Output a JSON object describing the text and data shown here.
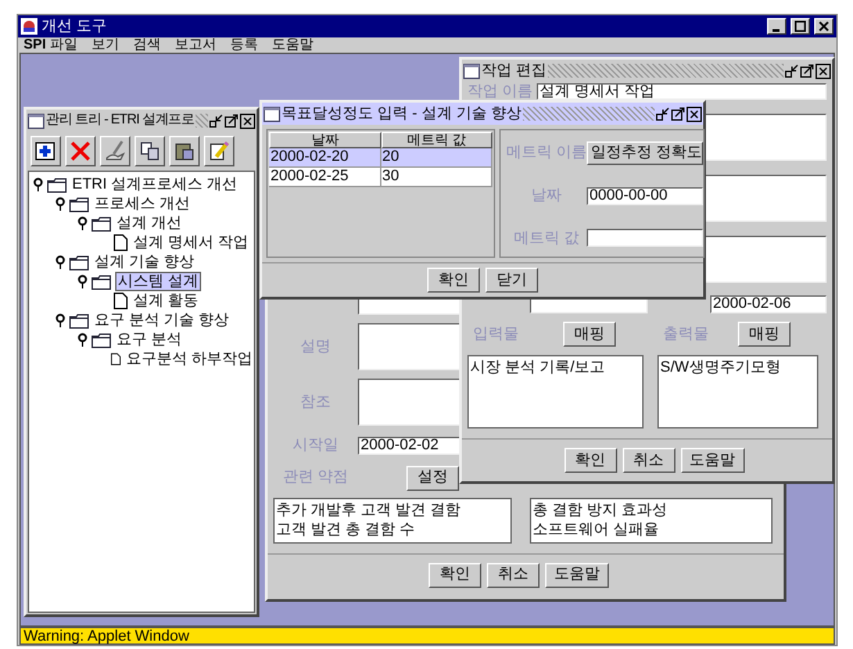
{
  "app": {
    "title": "개선 도구",
    "menu": [
      "**SPI** 파일",
      "보기",
      "검색",
      "보고서",
      "등록",
      "도움말"
    ]
  },
  "tree_window": {
    "title": "관리 트리 - ETRI 설계프로",
    "toolbar": [
      {
        "kind": "add"
      },
      {
        "kind": "delete"
      },
      {
        "kind": "edit"
      },
      {
        "kind": "copy"
      },
      {
        "kind": "paste"
      },
      {
        "kind": "pencil"
      }
    ],
    "tree": [
      {
        "label": "ETRI 설계프로세스 개선",
        "kind": "folder",
        "expanded": true,
        "selected": false,
        "children": [
          {
            "label": "프로세스 개선",
            "kind": "folder",
            "expanded": true,
            "selected": false,
            "children": [
              {
                "label": "설계 개선",
                "kind": "folder",
                "expanded": true,
                "selected": false,
                "children": [
                  {
                    "label": "설계 명세서 작업",
                    "kind": "doc",
                    "selected": false
                  }
                ]
              }
            ]
          },
          {
            "label": "설계 기술 향상",
            "kind": "folder",
            "expanded": true,
            "selected": false,
            "children": [
              {
                "label": "시스템 설계",
                "kind": "folder",
                "expanded": true,
                "selected": true,
                "children": [
                  {
                    "label": "설계 활동",
                    "kind": "doc",
                    "selected": false
                  }
                ]
              }
            ]
          },
          {
            "label": "요구 분석 기술 향상",
            "kind": "folder",
            "expanded": true,
            "selected": false,
            "children": [
              {
                "label": "요구 분석",
                "kind": "folder",
                "expanded": true,
                "selected": false,
                "children": [
                  {
                    "label": "요구분석 하부작업",
                    "kind": "doc",
                    "selected": false
                  }
                ]
              }
            ]
          }
        ]
      }
    ]
  },
  "goal_window": {
    "fields": [
      {
        "kind": "area",
        "label": "설명"
      },
      {
        "kind": "area",
        "label": "참조"
      },
      {
        "kind": "field",
        "label": "시작일",
        "value": "2000-02-02"
      }
    ],
    "weakness": {
      "label": "관련 약점",
      "button": "설정"
    },
    "lists": [
      [
        "추가 개발후 고객 발견 결함",
        "고객 발견 총 결함 수"
      ],
      [
        "총 결함 방지 효과성",
        "소프트웨어 실패율"
      ]
    ],
    "buttons": [
      "확인",
      "취소",
      "도움말"
    ]
  },
  "task_window": {
    "title": "작업 편집",
    "name_label": "작업 이름",
    "name": "설계 명세서 작업",
    "date": "2000-02-06",
    "io": [
      {
        "label": "입력물",
        "button": "매핑",
        "items": [
          "시장 분석 기록/보고"
        ]
      },
      {
        "label": "출력물",
        "button": "매핑",
        "items": [
          "S/W생명주기모형"
        ]
      }
    ],
    "buttons": [
      "확인",
      "취소",
      "도움말"
    ]
  },
  "metric_dialog": {
    "title": "목표달성정도 입력 - 설계 기술 향상",
    "columns": [
      "날짜",
      "메트릭 값"
    ],
    "rows": [
      {
        "cells": [
          "2000-02-20",
          "20"
        ],
        "selected": true
      },
      {
        "cells": [
          "2000-02-25",
          "30"
        ],
        "selected": false
      }
    ],
    "metric_label": "메트릭 이름",
    "metric": "일정추정 정확도",
    "date_label": "날짜",
    "date": "0000-00-00",
    "value_label": "메트릭 값",
    "buttons": [
      "확인",
      "닫기"
    ]
  },
  "status_bar": "Warning: Applet Window"
}
